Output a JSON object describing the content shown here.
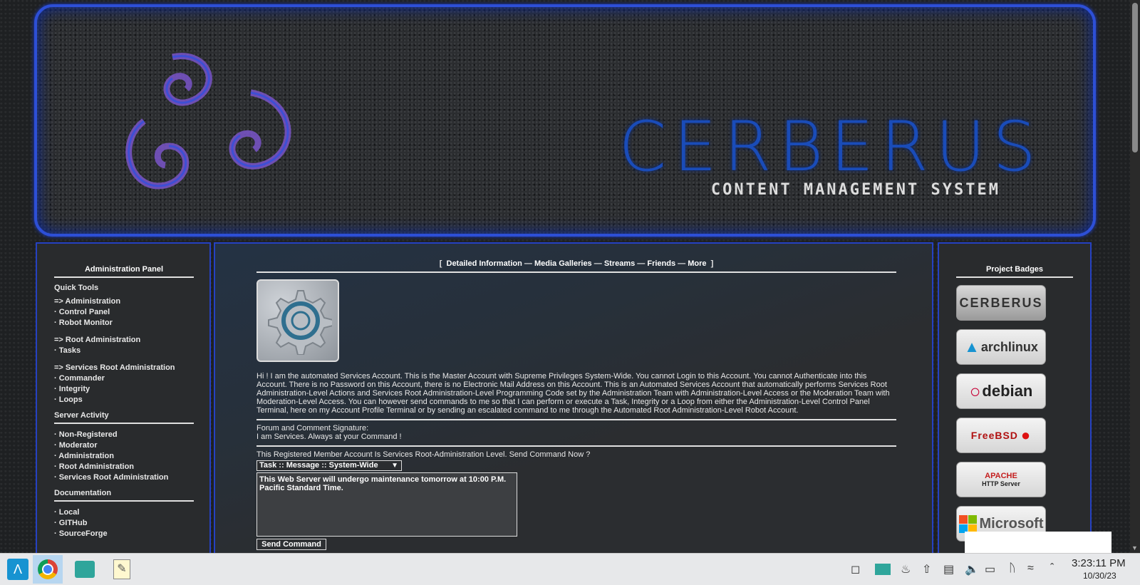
{
  "banner": {
    "title": "CERBERUS",
    "subtitle": "CONTENT MANAGEMENT SYSTEM"
  },
  "admin_panel": {
    "title": "Administration Panel",
    "quick_tools": {
      "heading": "Quick Tools",
      "groups": [
        {
          "head": "=> Administration",
          "items": [
            "· Control Panel",
            "· Robot Monitor"
          ]
        },
        {
          "head": "=> Root Administration",
          "items": [
            "· Tasks"
          ]
        },
        {
          "head": "=> Services Root Administration",
          "items": [
            "· Commander",
            "· Integrity",
            "· Loops"
          ]
        }
      ]
    },
    "server_activity": {
      "heading": "Server Activity",
      "items": [
        "· Non-Registered",
        "· Moderator",
        "· Administration",
        "· Root Administration",
        "· Services Root Administration"
      ]
    },
    "documentation": {
      "heading": "Documentation",
      "items": [
        "· Local",
        "· GITHub",
        "· SourceForge"
      ]
    }
  },
  "profile": {
    "nav": {
      "open": "[",
      "links": [
        "Detailed Information",
        "Media Galleries",
        "Streams",
        "Friends",
        "More"
      ],
      "separator": "—",
      "close": "]"
    },
    "bio": "Hi ! I am the automated Services Account. This is the Master Account with Supreme Privileges System-Wide. You cannot Login to this Account. You cannot Authenticate into this Account. There is no Password on this Account, there is no Electronic Mail Address on this Account. This is an Automated Services Account that automatically performs Services Root Administration-Level Actions and Services Root Administration-Level Programming Code set by the Administration Team with Administration-Level Access or the Moderation Team with Moderation-Level Access. You can however send commands to me so that I can perform or execute a Task, Integrity or a Loop from either the Administration-Level Control Panel Terminal, here on my Account Profile Terminal or by sending an escalated command to me through the Automated Root Administration-Level Robot Account.",
    "signature_label": "Forum and Comment Signature:",
    "signature": "I am Services. Always at your Command !",
    "command_prompt": "This Registered Member Account Is Services Root-Administration Level. Send Command Now ?",
    "command_select": "Task :: Message :: System-Wide",
    "command_text": "This Web Server will undergo maintenance tomorrow at 10:00 P.M. Pacific Standard Time.",
    "send_button": "Send Command"
  },
  "badges": {
    "title": "Project Badges",
    "items": [
      "CERBERUS",
      "archlinux",
      "debian",
      "FreeBSD",
      "APACHE",
      "HTTP Server",
      "Microsoft"
    ]
  },
  "taskbar": {
    "time": "3:23:11 PM",
    "date": "10/30/23",
    "colors": {
      "accent": "#2541c2",
      "brand_blue": "#1a4cb8"
    }
  }
}
